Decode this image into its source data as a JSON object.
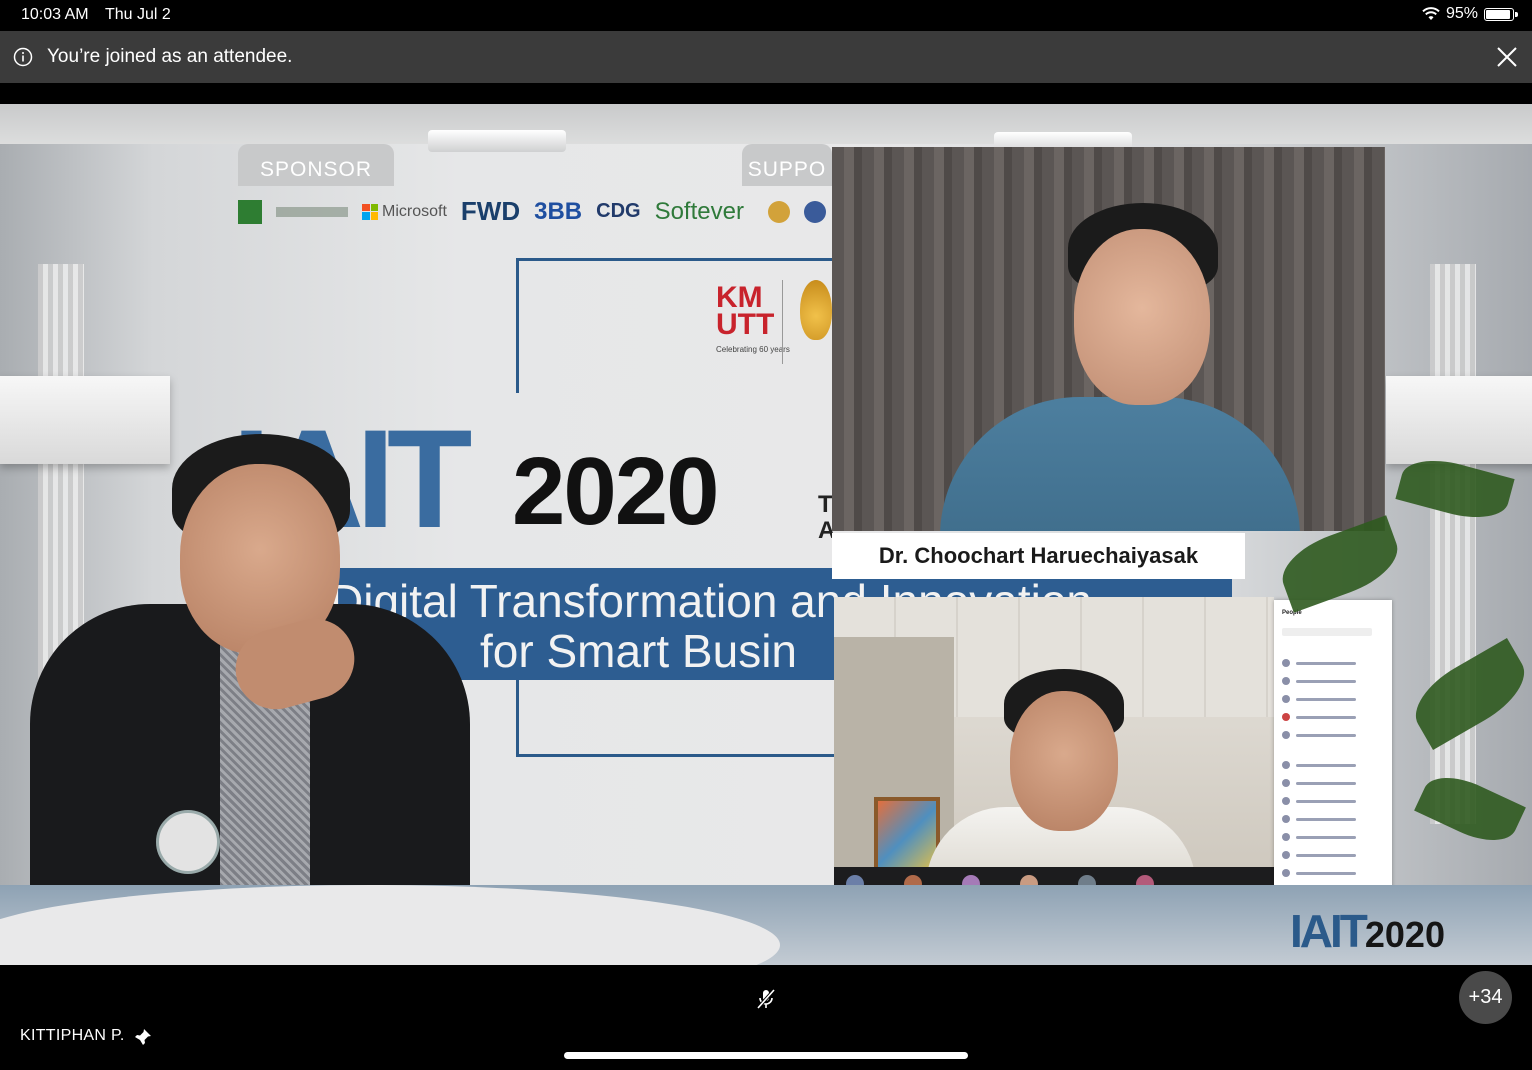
{
  "status_bar": {
    "time": "10:03 AM",
    "date": "Thu Jul 2",
    "battery_percent_label": "95%",
    "battery_level": 0.95,
    "wifi_icon": "wifi-icon",
    "battery_icon": "battery-icon"
  },
  "banner": {
    "message": "You’re joined as an attendee.",
    "info_icon": "info-icon",
    "close_icon": "close-icon"
  },
  "stage": {
    "sponsor_label": "SPONSOR",
    "support_label": "SUPPO",
    "sponsor_logos": [
      "Microsoft",
      "FWD",
      "3BB",
      "CDG",
      "Softever"
    ],
    "event_logo": "IAIT",
    "event_year": "2020",
    "university_logo": "KM UTT",
    "university_caption": "Celebrating 60 years",
    "side_text": "T\nA",
    "ribbon_line1": "Digital Transformation and Innovation",
    "ribbon_line2": "for Smart Busin",
    "corner_logo": "IAIT",
    "corner_year": "2020"
  },
  "participants": {
    "featured_speaker_name": "Dr. Choochart Haruechaiyasak",
    "people_panel_title": "People",
    "self_name": "KITTIPHAN P.",
    "overflow_count": "+34"
  },
  "controls": {
    "mic_icon": "mic-off-icon",
    "pin_icon": "pin-icon"
  }
}
